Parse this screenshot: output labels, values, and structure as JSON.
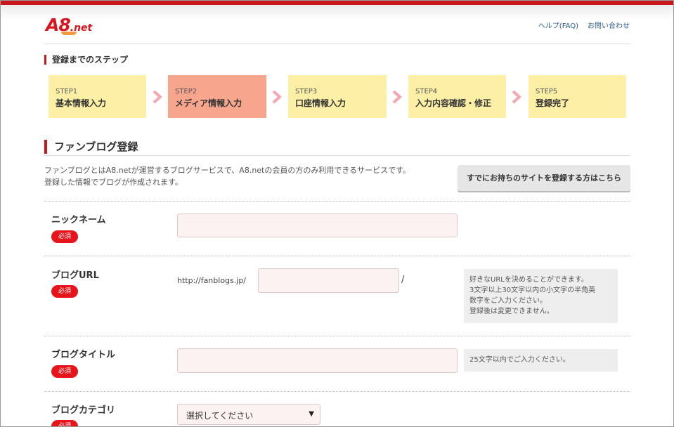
{
  "header": {
    "logo_main": "A8",
    "logo_suffix": ".net",
    "links": [
      "ヘルプ(FAQ)",
      "お問い合わせ"
    ]
  },
  "steps_section": {
    "title": "登録までのステップ",
    "active_index": 1,
    "steps": [
      {
        "num": "STEP1",
        "label": "基本情報入力"
      },
      {
        "num": "STEP2",
        "label": "メディア情報入力"
      },
      {
        "num": "STEP3",
        "label": "口座情報入力"
      },
      {
        "num": "STEP4",
        "label": "入力内容確認・修正"
      },
      {
        "num": "STEP5",
        "label": "登録完了"
      }
    ]
  },
  "form": {
    "title": "ファンブログ登録",
    "description_line1": "ファンブログとはA8.netが運営するブログサービスで、A8.netの会員の方のみ利用できるサービスです。",
    "description_line2": "登録した情報でブログが作成されます。",
    "existing_site_button": "すでにお持ちのサイトを登録する方はこちら",
    "required_badge": "必須",
    "fields": {
      "nickname": {
        "label": "ニックネーム",
        "value": ""
      },
      "blog_url": {
        "label": "ブログURL",
        "prefix": "http://fanblogs.jp/",
        "suffix": "/",
        "value": "",
        "note_lines": [
          "好きなURLを決めることができます。",
          "3文字以上30文字以内の小文字の半角英",
          "数字をご入力ください。",
          "登録後は変更できません。"
        ]
      },
      "blog_title": {
        "label": "ブログタイトル",
        "value": "",
        "note": "25文字以内でご入力ください。"
      },
      "blog_category": {
        "label": "ブログカテゴリ",
        "selected": "選択してください"
      }
    }
  },
  "colors": {
    "brand_red": "#c8161d",
    "step_yellow": "#fdf0a6",
    "step_active": "#f7a58c",
    "arrow_pink": "#f4a7b0",
    "field_bg": "#fdf2f2"
  }
}
